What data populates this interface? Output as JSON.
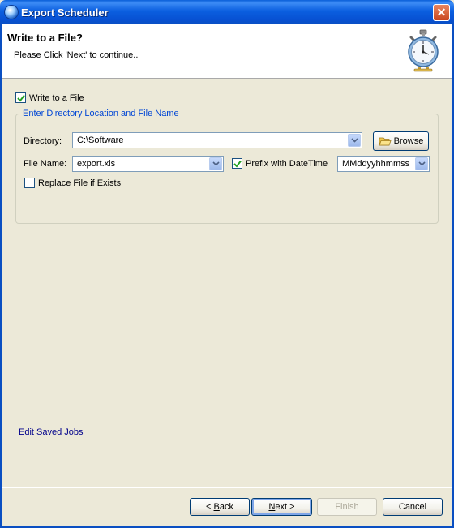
{
  "window": {
    "title": "Export Scheduler",
    "close_glyph": "✕"
  },
  "header": {
    "title": "Write to a File?",
    "subtitle": "Please Click 'Next' to continue..",
    "icon": "stopwatch-icon"
  },
  "write_to_file": {
    "label": "Write to a File",
    "checked": true
  },
  "group": {
    "legend": "Enter Directory Location and File Name",
    "directory_label": "Directory:",
    "directory_value": "C:\\Software",
    "browse_label": "Browse",
    "file_name_label": "File Name:",
    "file_name_value": "export.xls",
    "prefix_label": "Prefix with DateTime",
    "prefix_checked": true,
    "datetime_format": "MMddyyhhmmss",
    "replace_label": "Replace File if Exists",
    "replace_checked": false
  },
  "edit_jobs_link": "Edit Saved Jobs",
  "buttons": {
    "back_prefix": "< ",
    "back_mnemonic": "B",
    "back_suffix": "ack",
    "next_mnemonic": "N",
    "next_suffix": "ext >",
    "finish": "Finish",
    "cancel": "Cancel"
  },
  "colors": {
    "titlebar": "#0A5FD9",
    "dialog_bg": "#ECE9D8",
    "legend": "#0046D5",
    "link": "#00008B"
  }
}
